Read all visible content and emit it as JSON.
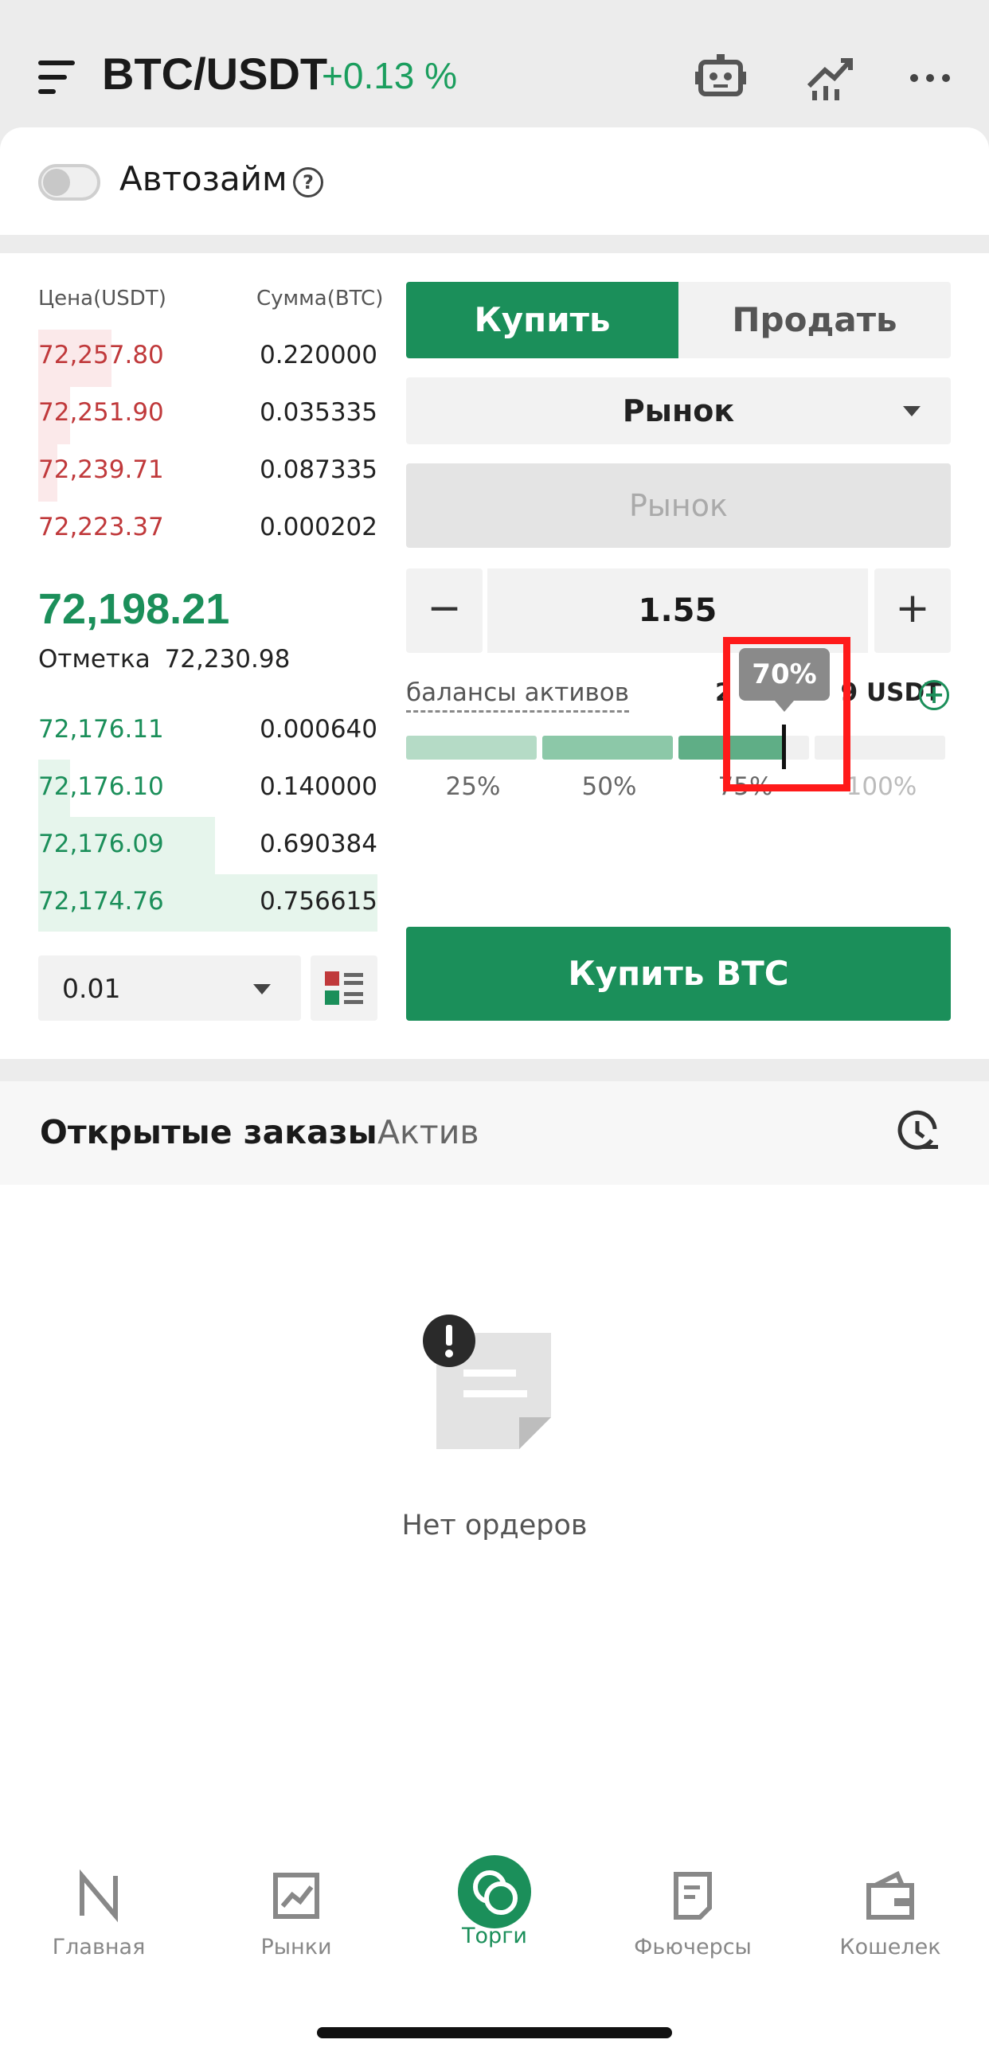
{
  "header": {
    "pair": "BTC/USDT",
    "change": "+0.13 %",
    "icons": [
      "menu-icon",
      "robot-icon",
      "chart-growth-icon",
      "more-icon"
    ]
  },
  "autoloan": {
    "label": "Автозайм",
    "help": "?",
    "enabled": false
  },
  "orderbook": {
    "price_header": "Цена(USDT)",
    "amount_header": "Сумма(BTC)",
    "asks": [
      {
        "price": "72,257.80",
        "amount": "0.220000"
      },
      {
        "price": "72,251.90",
        "amount": "0.035335"
      },
      {
        "price": "72,239.71",
        "amount": "0.087335"
      },
      {
        "price": "72,223.37",
        "amount": "0.000202"
      }
    ],
    "last_price": "72,198.21",
    "mark_label": "Отметка",
    "mark_price": "72,230.98",
    "bids": [
      {
        "price": "72,176.11",
        "amount": "0.000640"
      },
      {
        "price": "72,176.10",
        "amount": "0.140000"
      },
      {
        "price": "72,176.09",
        "amount": "0.690384"
      },
      {
        "price": "72,174.76",
        "amount": "0.756615"
      }
    ],
    "precision": "0.01"
  },
  "form": {
    "buy_tab": "Купить",
    "sell_tab": "Продать",
    "order_type": "Рынок",
    "price_placeholder": "Рынок",
    "qty_minus": "−",
    "quantity": "1.55",
    "qty_plus": "+",
    "balance_label": "балансы активов",
    "balance_value_partial": "2",
    "balance_value_tail": "9 USDT",
    "slider_percent": 70,
    "tooltip": "70%",
    "marks": [
      "25%",
      "50%",
      "75%",
      "100%"
    ],
    "submit": "Купить BTC"
  },
  "orders": {
    "tab_open": "Открытые заказы",
    "tab_assets": "Актив",
    "empty_text": "Нет ордеров"
  },
  "nav": [
    {
      "label": "Главная",
      "icon": "logo-icon",
      "active": false
    },
    {
      "label": "Рынки",
      "icon": "market-chart-icon",
      "active": false
    },
    {
      "label": "Торги",
      "icon": "trade-icon",
      "active": true
    },
    {
      "label": "Фьючерсы",
      "icon": "futures-icon",
      "active": false
    },
    {
      "label": "Кошелек",
      "icon": "wallet-icon",
      "active": false
    }
  ],
  "colors": {
    "green": "#1b8f5a",
    "red": "#c0393b",
    "highlight": "#ff1a1a"
  }
}
